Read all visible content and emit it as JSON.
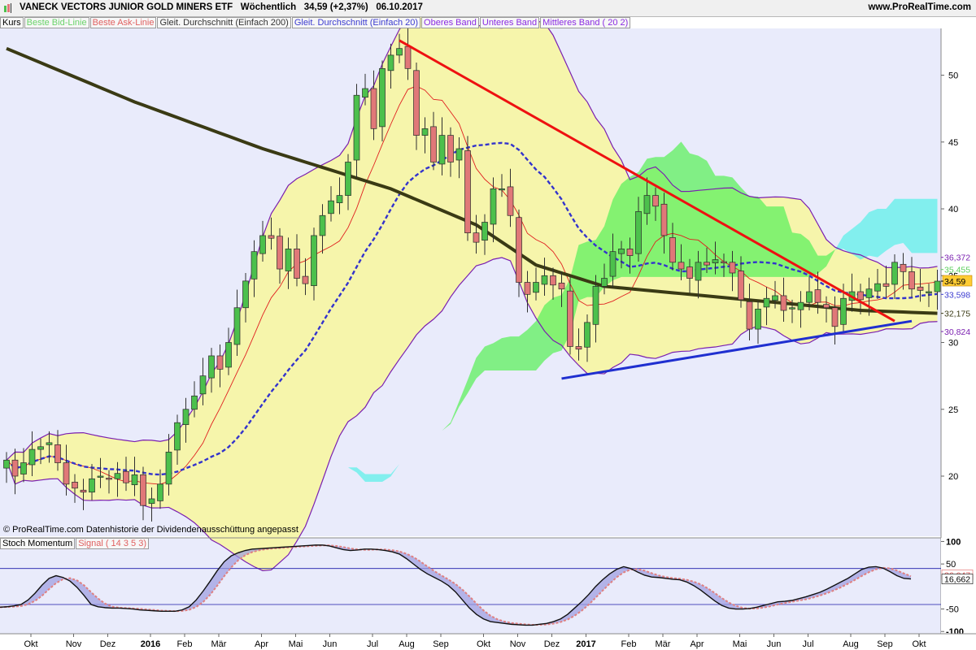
{
  "header": {
    "title": "VANECK VECTORS JUNIOR GOLD MINERS ETF",
    "period": "Wöchentlich",
    "last": "34,59 (+2,37%)",
    "date": "06.10.2017",
    "site": "www.ProRealTime.com"
  },
  "legend": [
    {
      "label": "Kurs",
      "color": "#000000"
    },
    {
      "label": "Beste Bid-Linie",
      "color": "#6ad36a"
    },
    {
      "label": "Beste Ask-Linie",
      "color": "#e06060"
    },
    {
      "label": "Gleit. Durchschnitt (Einfach 200)",
      "color": "#333333"
    },
    {
      "label": "Gleit. Durchschnitt (Einfach 20)",
      "color": "#3b3bd0"
    },
    {
      "label": "Oberes Band",
      "color": "#8a2be2"
    },
    {
      "label": "Unteres Band",
      "color": "#8a2be2"
    },
    {
      "label": "Mittleres Band ( 20 2)",
      "color": "#8a2be2"
    }
  ],
  "copyright": "© ProRealTime.com Datenhistorie der Dividendenausschüttung angepasst",
  "lower_legend": [
    {
      "label": "Stoch Momentum",
      "color": "#000000"
    },
    {
      "label": "Signal ( 14 3 5 3)",
      "color": "#e06060"
    }
  ],
  "colors": {
    "up": "#4cc04c",
    "down": "#e07878",
    "ma200": "#3a3a14",
    "ma20": "#3333cc",
    "trend_down": "#ee1111",
    "trend_up": "#1f2fd0",
    "bb": "#7a1fb0",
    "cloud_green": "#5ef05e",
    "cloud_cyan": "#5ff0ea"
  },
  "chart_data": {
    "type": "candlestick",
    "price_axis": {
      "ticks": [
        20,
        25,
        30,
        35,
        40,
        45,
        50
      ],
      "ylim": [
        15.5,
        53.5
      ]
    },
    "right_labels": [
      {
        "text": "36,372",
        "value": 36.37,
        "color": "#7a1fb0"
      },
      {
        "text": "35,455",
        "value": 35.46,
        "color": "#5ccf5c"
      },
      {
        "text": "34,59",
        "value": 34.59,
        "color": "#000000",
        "highlight": "#ffcc33"
      },
      {
        "text": "33,598",
        "value": 33.6,
        "color": "#3b3bd0"
      },
      {
        "text": "32,175",
        "value": 32.18,
        "color": "#3a3a14"
      },
      {
        "text": "30,824",
        "value": 30.82,
        "color": "#7a1fb0"
      }
    ],
    "x_labels": [
      {
        "label": "Okt",
        "w": 0
      },
      {
        "label": "Nov",
        "w": 5
      },
      {
        "label": "Dez",
        "w": 9
      },
      {
        "label": "2016",
        "w": 14,
        "bold": true
      },
      {
        "label": "Feb",
        "w": 18
      },
      {
        "label": "Mär",
        "w": 22
      },
      {
        "label": "Apr",
        "w": 27
      },
      {
        "label": "Mai",
        "w": 31
      },
      {
        "label": "Jun",
        "w": 35
      },
      {
        "label": "Jul",
        "w": 40
      },
      {
        "label": "Aug",
        "w": 44
      },
      {
        "label": "Sep",
        "w": 48
      },
      {
        "label": "Okt",
        "w": 53
      },
      {
        "label": "Nov",
        "w": 57
      },
      {
        "label": "Dez",
        "w": 61
      },
      {
        "label": "2017",
        "w": 65,
        "bold": true
      },
      {
        "label": "Feb",
        "w": 70
      },
      {
        "label": "Mär",
        "w": 74
      },
      {
        "label": "Apr",
        "w": 78
      },
      {
        "label": "Mai",
        "w": 83
      },
      {
        "label": "Jun",
        "w": 87
      },
      {
        "label": "Jul",
        "w": 91
      },
      {
        "label": "Aug",
        "w": 96
      },
      {
        "label": "Sep",
        "w": 100
      },
      {
        "label": "Okt",
        "w": 104
      }
    ],
    "closes": [
      21.2,
      20.0,
      21.0,
      22.0,
      22.2,
      22.5,
      21.0,
      19.4,
      19.1,
      18.8,
      19.8,
      20.0,
      19.8,
      20.2,
      19.5,
      20.1,
      17.8,
      18.3,
      19.4,
      21.8,
      24.0,
      25.0,
      26.0,
      27.5,
      29.0,
      28.0,
      30.0,
      32.6,
      34.6,
      36.8,
      38.0,
      37.8,
      35.5,
      37.0,
      34.8,
      34.4,
      38.0,
      39.5,
      40.6,
      41.0,
      43.5,
      48.5,
      49.0,
      46.0,
      50.5,
      51.5,
      52.0,
      50.5,
      45.5,
      46.0,
      43.5,
      45.5,
      43.5,
      44.5,
      38.2,
      37.5,
      39.0,
      41.5,
      41.5,
      39.5,
      34.5,
      33.6,
      34.5,
      35.0,
      34.3,
      34.0,
      29.7,
      29.5,
      31.5,
      34.2,
      34.8,
      36.8,
      37.0,
      36.5,
      39.8,
      41.0,
      40.2,
      38.0,
      36.0,
      35.5,
      34.8,
      36.0,
      35.8,
      36.2,
      36.0,
      35.2,
      33.2,
      31.0,
      32.5,
      33.3,
      33.5,
      32.4,
      32.6,
      33.0,
      33.8,
      33.0,
      32.6,
      31.2,
      33.3,
      33.8,
      33.2,
      34.0,
      34.4,
      34.2,
      36.0,
      35.3,
      34.0,
      33.9,
      33.8,
      34.59
    ]
  },
  "stoch_chart": {
    "type": "line",
    "ylim": [
      -105,
      108
    ],
    "ticks": [
      100,
      50,
      -50,
      -100
    ],
    "levels": [
      40,
      -40
    ],
    "value_labels": [
      {
        "text": "26,047",
        "value": 26.05,
        "color": "#e06060"
      },
      {
        "text": "16,662",
        "value": 16.66,
        "color": "#000000"
      }
    ],
    "momentum": [
      -46,
      -45,
      -43,
      -40,
      -30,
      -15,
      3,
      18,
      24,
      20,
      12,
      -2,
      -20,
      -40,
      -45,
      -47,
      -48,
      -48,
      -49,
      -50,
      -52,
      -53,
      -54,
      -55,
      -55,
      -55,
      -52,
      -45,
      -30,
      -10,
      12,
      35,
      55,
      68,
      75,
      80,
      83,
      84,
      85,
      86,
      87,
      88,
      89,
      90,
      91,
      92,
      92,
      90,
      86,
      82,
      80,
      81,
      83,
      83,
      82,
      80,
      77,
      72,
      62,
      50,
      38,
      28,
      20,
      12,
      2,
      -12,
      -30,
      -48,
      -62,
      -72,
      -78,
      -80,
      -82,
      -84,
      -85,
      -86,
      -86,
      -84,
      -82,
      -78,
      -72,
      -62,
      -48,
      -34,
      -18,
      0,
      15,
      28,
      38,
      44,
      40,
      32,
      25,
      21,
      20,
      18,
      16,
      15,
      10,
      2,
      -8,
      -20,
      -32,
      -42,
      -48,
      -50,
      -50,
      -49,
      -46,
      -42,
      -38,
      -34,
      -33,
      -31,
      -27,
      -23,
      -18,
      -13,
      -6,
      2,
      10,
      18,
      28,
      38,
      43,
      44,
      41,
      33,
      24,
      18,
      16.7
    ]
  }
}
